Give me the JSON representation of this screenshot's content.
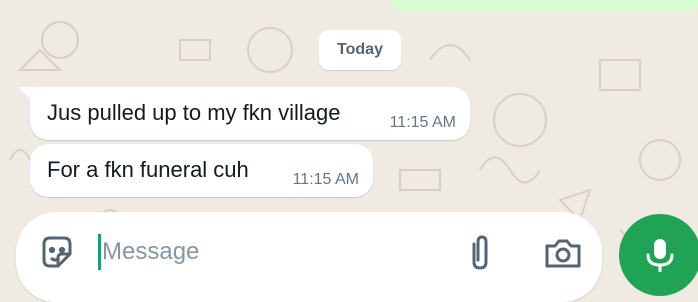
{
  "chat": {
    "date_label": "Today",
    "messages": [
      {
        "text": "Jus pulled up to my fkn village",
        "time": "11:15 AM",
        "direction": "incoming"
      },
      {
        "text": "For a fkn funeral cuh",
        "time": "11:15 AM",
        "direction": "incoming"
      }
    ]
  },
  "composer": {
    "placeholder": "Message",
    "value": "",
    "icons": [
      "sticker-icon",
      "paperclip-icon",
      "camera-icon",
      "microphone-icon"
    ]
  },
  "colors": {
    "wallpaper": "#efeae2",
    "incoming_bubble": "#ffffff",
    "outgoing_bubble": "#d9fdd3",
    "accent": "#00a884",
    "mic_button": "#21a356"
  }
}
